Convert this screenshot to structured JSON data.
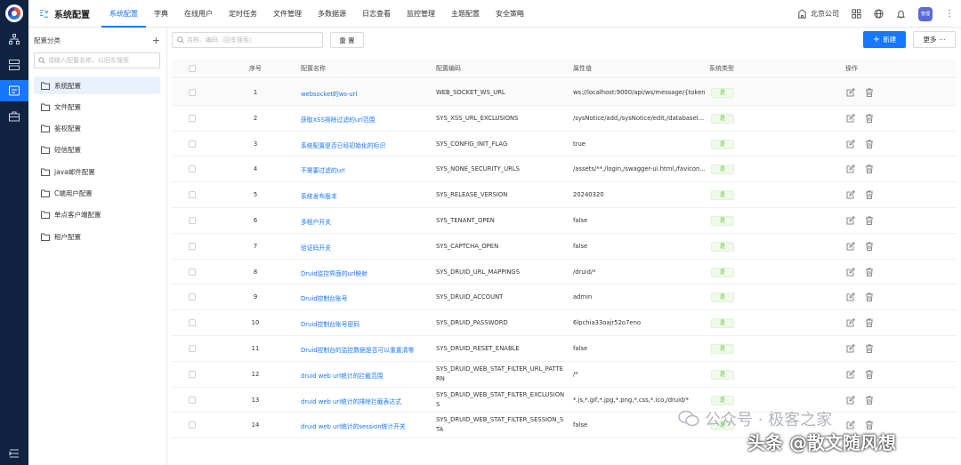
{
  "app": {
    "title": "系统配置",
    "tabs": [
      "系统配置",
      "字典",
      "在线用户",
      "定时任务",
      "文件管理",
      "多数据源",
      "日志查看",
      "监控管理",
      "主题配置",
      "安全策略"
    ],
    "company": "北京公司",
    "avatar_text": "管理"
  },
  "sidebar": {
    "header": "配置分类",
    "add_symbol": "+",
    "search_placeholder": "请输入配置名称，以回车搜索",
    "items": [
      {
        "label": "系统配置"
      },
      {
        "label": "文件配置"
      },
      {
        "label": "鉴权配置"
      },
      {
        "label": "短信配置"
      },
      {
        "label": "java邮件配置"
      },
      {
        "label": "C端用户配置"
      },
      {
        "label": "单点客户端配置"
      },
      {
        "label": "租户配置"
      }
    ]
  },
  "toolbar": {
    "search_placeholder": "名称、编码（回车搜索）",
    "reset_label": "重 置",
    "new_label": "新建",
    "more_label": "更多"
  },
  "table": {
    "columns": [
      "序号",
      "配置名称",
      "配置编码",
      "属性值",
      "系统类型",
      "操作"
    ],
    "rows": [
      {
        "index": "1",
        "name": "websocket的ws-url",
        "code": "WEB_SOCKET_WS_URL",
        "value": "ws://localhost:9000/api/ws/message/{token}",
        "type": "是"
      },
      {
        "index": "2",
        "name": "获取XSS排除过滤的url范围",
        "code": "SYS_XSS_URL_EXCLUSIONS",
        "value": "/sysNotice/add,/sysNotice/edit,/databasel...",
        "type": "是"
      },
      {
        "index": "3",
        "name": "系统配置是否已经初始化的标识",
        "code": "SYS_CONFIG_INIT_FLAG",
        "value": "true",
        "type": "是"
      },
      {
        "index": "4",
        "name": "不需要过滤的url",
        "code": "SYS_NONE_SECURITY_URLS",
        "value": "/assets/**,/login,/swagger-ui.html,/favicon...",
        "type": "是"
      },
      {
        "index": "5",
        "name": "系统发布版本",
        "code": "SYS_RELEASE_VERSION",
        "value": "20240320",
        "type": "是"
      },
      {
        "index": "6",
        "name": "多租户开关",
        "code": "SYS_TENANT_OPEN",
        "value": "false",
        "type": "是"
      },
      {
        "index": "7",
        "name": "验证码开关",
        "code": "SYS_CAPTCHA_OPEN",
        "value": "false",
        "type": "是"
      },
      {
        "index": "8",
        "name": "Druid监控界面的url映射",
        "code": "SYS_DRUID_URL_MAPPINGS",
        "value": "/druid/*",
        "type": "是"
      },
      {
        "index": "9",
        "name": "Druid控制台账号",
        "code": "SYS_DRUID_ACCOUNT",
        "value": "admin",
        "type": "是"
      },
      {
        "index": "10",
        "name": "Druid控制台账号密码",
        "code": "SYS_DRUID_PASSWORD",
        "value": "6lpchia33oajr52o7eno",
        "type": "是"
      },
      {
        "index": "11",
        "name": "Druid控制台的监控数据是否可以重置清零",
        "code": "SYS_DRUID_RESET_ENABLE",
        "value": "false",
        "type": "是"
      },
      {
        "index": "12",
        "name": "druid web url统计的拦截范围",
        "code": "SYS_DRUID_WEB_STAT_FILTER_URL_PATTERN",
        "value": "/*",
        "type": "是"
      },
      {
        "index": "13",
        "name": "druid web url统计的排除拦截表达式",
        "code": "SYS_DRUID_WEB_STAT_FILTER_EXCLUSIONS",
        "value": "*.js,*.gif,*.jpg,*.png,*.css,*.ico,/druid/*",
        "type": "是"
      },
      {
        "index": "14",
        "name": "druid web url统计的session统计开关",
        "code": "SYS_DRUID_WEB_STAT_FILTER_SESSION_STA",
        "value": "false",
        "type": "是"
      }
    ]
  },
  "watermark": {
    "line1": "公众号 · 极客之家",
    "line2": "头条 @散文随风想"
  }
}
